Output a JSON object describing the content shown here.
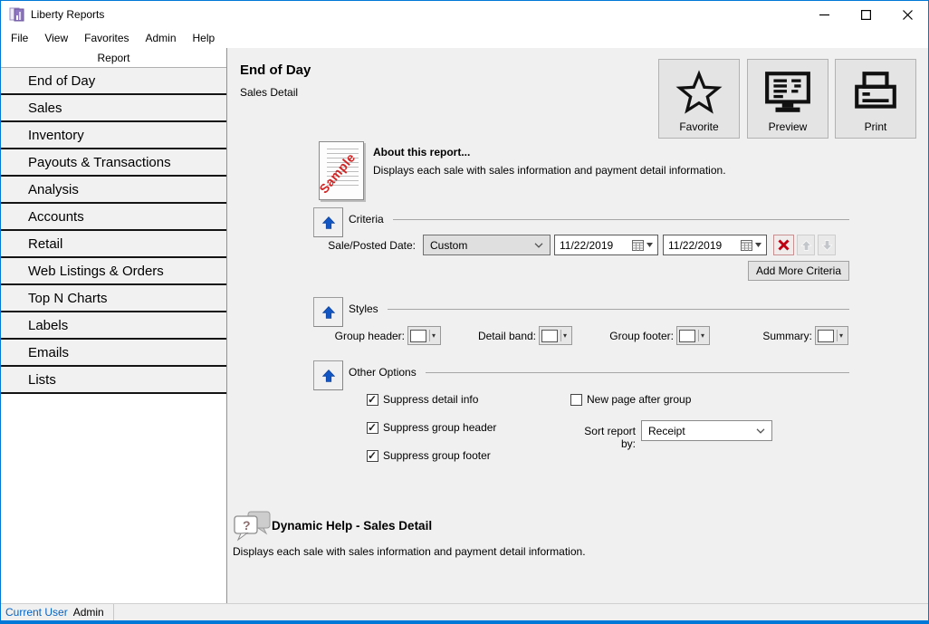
{
  "window": {
    "title": "Liberty Reports"
  },
  "menu": {
    "items": [
      {
        "label": "File"
      },
      {
        "label": "View"
      },
      {
        "label": "Favorites"
      },
      {
        "label": "Admin"
      },
      {
        "label": "Help"
      }
    ]
  },
  "sidebar": {
    "header": "Report",
    "items": [
      {
        "label": "End of Day"
      },
      {
        "label": "Sales"
      },
      {
        "label": "Inventory"
      },
      {
        "label": "Payouts & Transactions"
      },
      {
        "label": "Analysis"
      },
      {
        "label": "Accounts"
      },
      {
        "label": "Retail"
      },
      {
        "label": "Web Listings & Orders"
      },
      {
        "label": "Top N Charts"
      },
      {
        "label": "Labels"
      },
      {
        "label": "Emails"
      },
      {
        "label": "Lists"
      }
    ]
  },
  "main": {
    "title": "End of Day",
    "subtitle": "Sales Detail",
    "actions": {
      "favorite": "Favorite",
      "preview": "Preview",
      "print": "Print"
    },
    "about": {
      "heading": "About this report...",
      "description": "Displays each sale with sales information and payment detail information.",
      "sample_text": "Sample"
    },
    "criteria": {
      "heading": "Criteria",
      "date_label": "Sale/Posted Date:",
      "date_mode": "Custom",
      "date_from": "11/22/2019",
      "date_to": "11/22/2019",
      "add_more": "Add More Criteria"
    },
    "styles": {
      "heading": "Styles",
      "group_header_label": "Group header:",
      "detail_band_label": "Detail band:",
      "group_footer_label": "Group footer:",
      "summary_label": "Summary:"
    },
    "options": {
      "heading": "Other Options",
      "checkboxes": [
        {
          "label": "Suppress detail info",
          "checked": true
        },
        {
          "label": "Suppress group header",
          "checked": true
        },
        {
          "label": "Suppress group footer",
          "checked": true
        },
        {
          "label": "New page after group",
          "checked": false
        }
      ],
      "sort_label": "Sort report by:",
      "sort_value": "Receipt"
    },
    "help": {
      "heading": "Dynamic Help - Sales Detail",
      "description": "Displays each sale with sales information and payment detail information."
    }
  },
  "statusbar": {
    "user_label": "Current User",
    "user_value": "Admin"
  },
  "icons": {
    "question_mark": "?"
  },
  "colors": {
    "accent": "#0078d7",
    "link_blue": "#0563c1",
    "section_arrow_blue": "#1256c4",
    "delete_red": "#bf0012",
    "sample_red": "#d22525"
  }
}
